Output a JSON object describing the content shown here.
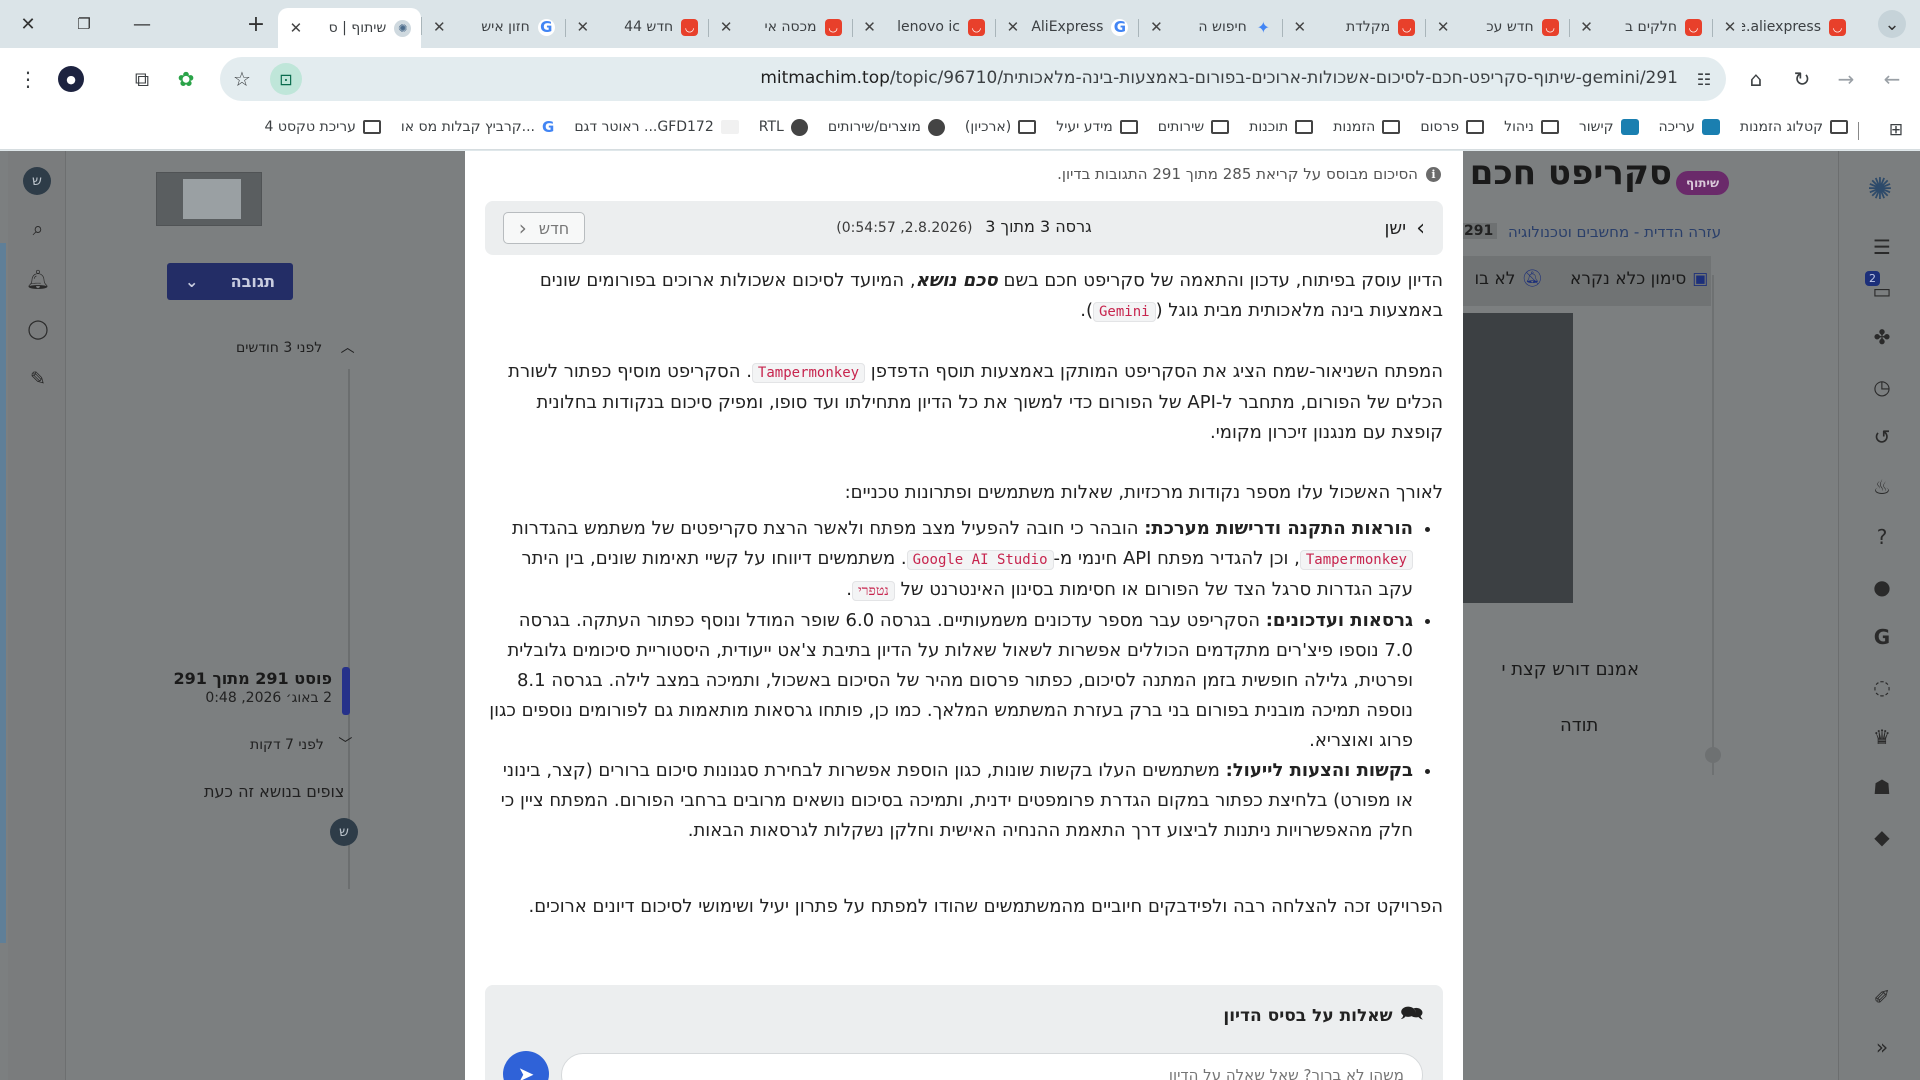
{
  "tabs": [
    {
      "title": "he.aliexpress",
      "fav": "red",
      "active": false
    },
    {
      "title": "חלקים ב",
      "fav": "red",
      "active": false
    },
    {
      "title": "חדש עכ",
      "fav": "red",
      "active": false
    },
    {
      "title": "מקלדת",
      "fav": "red",
      "active": false
    },
    {
      "title": "חיפוש ה",
      "fav": "gem",
      "active": false
    },
    {
      "title": "AliExpress",
      "fav": "g",
      "active": false
    },
    {
      "title": "lenovo ic",
      "fav": "red",
      "active": false
    },
    {
      "title": "מכסה אי",
      "fav": "red",
      "active": false
    },
    {
      "title": "חדש 44",
      "fav": "red",
      "active": false
    },
    {
      "title": "חזון איש",
      "fav": "g",
      "active": false
    },
    {
      "title": "שיתוף | ס",
      "fav": "logo",
      "active": true
    }
  ],
  "url": {
    "domain": "mitmachim.top",
    "path": "/topic/96710/שיתוף-סקריפט-חכם-לסיכום-אשכולות-ארוכים-בפורום-באמצעות-בינה-מלאכותית-gemini/291"
  },
  "bookmarks": [
    {
      "label": "קטלוג הזמנות",
      "icon": "folder"
    },
    {
      "label": "עריכה",
      "icon": "edit"
    },
    {
      "label": "קישור",
      "icon": "edit"
    },
    {
      "label": "ניהול",
      "icon": "folder"
    },
    {
      "label": "פרסום",
      "icon": "folder"
    },
    {
      "label": "הזמנות",
      "icon": "folder"
    },
    {
      "label": "תוכנות",
      "icon": "folder"
    },
    {
      "label": "שירותים",
      "icon": "folder"
    },
    {
      "label": "מידע יעיל",
      "icon": "folder"
    },
    {
      "label": "(ארכיון)",
      "icon": "folder"
    },
    {
      "label": "מוצרים/שירותים",
      "icon": "glob"
    },
    {
      "label": "RTL",
      "icon": "glob"
    },
    {
      "label": "ראוטר דגם ...GFD172",
      "icon": "blank"
    },
    {
      "label": "קרביץ קבלות מס או...",
      "icon": "g"
    },
    {
      "label": "4 עריכת טקסט",
      "icon": "folder"
    }
  ],
  "left_panel": {
    "reply_label": "תגובה",
    "ago_top": "לפני 3 חודשים",
    "post_counter": "פוסט 291 מתוך 291",
    "post_date": "2 באוג׳ 2026, 0:48",
    "ago_bottom": "לפני 7 דקות",
    "viewers": "צופים בנושא זה כעת",
    "avatar_letter": "ש"
  },
  "right_panel": {
    "topic_title": "סקריפט חכם ל",
    "share_label": "שיתוף",
    "category": "עזרה הדדית - מחשבים וטכנולוגיה",
    "count": "291",
    "mark_read": "סימון כלא נקרא",
    "not_watching": "לא בו",
    "snippet1": "אמנם דורש קצת י",
    "snippet2": "תודה",
    "notif_badge": "2"
  },
  "modal": {
    "summary_note": "הסיכום מבוסס על קריאת 285 מתוך 291 התגובות בדיון.",
    "older_label": "ישן",
    "newer_label": "חדש",
    "version_text": "גרסה 3 מתוך 3",
    "version_date": "(2.8.2026, 0:54:57)",
    "p1_a": "הדיון עוסק בפיתוח, עדכון והתאמה של סקריפט חכם בשם ",
    "p1_em": "סכם נושא",
    "p1_b": ", המיועד לסיכום אשכולות ארוכים בפורומים שונים באמצעות בינה מלאכותית מבית גוגל (",
    "p1_code": "Gemini",
    "p1_c": ").",
    "p2_a": "המפתח השניאור-שמח הציג את הסקריפט המותקן באמצעות תוסף הדפדפן ",
    "p2_code": "Tampermonkey",
    "p2_b": ". הסקריפט מוסיף כפתור לשורת הכלים של הפורום, מתחבר ל-API של הפורום כדי למשוך את כל הדיון מתחילתו ועד סופו, ומפיק סיכום בנקודות בחלונית קופצת עם מנגנון זיכרון מקומי.",
    "p3": "לאורך האשכול עלו מספר נקודות מרכזיות, שאלות משתמשים ופתרונות טכניים:",
    "li1_bold": "הוראות התקנה ודרישות מערכת:",
    "li1_a": " הובהר כי חובה להפעיל מצב מפתח ולאשר הרצת סקריפטים של משתמש בהגדרות ",
    "li1_code1": "Tampermonkey",
    "li1_b": ", וכן להגדיר מפתח API חינמי מ-",
    "li1_code2": "Google AI Studio",
    "li1_c": ". משתמשים דיווחו על קשיי תאימות שונים, בין היתר עקב הגדרות סרגל הצד של הפורום או חסימות בסינון האינטרנט של ",
    "li1_code3": "נטפרי",
    "li1_d": ".",
    "li2_bold": "גרסאות ועדכונים:",
    "li2_text": " הסקריפט עבר מספר עדכונים משמעותיים. בגרסה 6.0 שופר המודל ונוסף כפתור העתקה. בגרסה 7.0 נוספו פיצ'רים מתקדמים הכוללים אפשרות לשאול שאלות על הדיון בתיבת צ'אט ייעודית, היסטוריית סיכומים גלובלית ופרטית, גלילה חופשית בזמן המתנה לסיכום, כפתור פרסום מהיר של הסיכום באשכול, ותמיכה במצב לילה. בגרסה 8.1 נוספה תמיכה מובנית בפורום בני ברק בעזרת המשתמש המלאך. כמו כן, פותחו גרסאות מותאמות גם לפורומים נוספים כגון פרוג ואוצריא.",
    "li3_bold": "בקשות והצעות לייעול:",
    "li3_text": " משתמשים העלו בקשות שונות, כגון הוספת אפשרות לבחירת סגנונות סיכום ברורים (קצר, בינוני או מפורט) בלחיצת כפתור במקום הגדרת פרומפטים ידנית, ותמיכה בסיכום נושאים מרובים ברחבי הפורום. המפתח ציין כי חלק מהאפשרויות ניתנות לביצוע דרך התאמת ההנחיה האישית וחלקן נשקלות לגרסאות הבאות.",
    "p4": "הפרויקט זכה להצלחה רבה ולפידבקים חיוביים מהמשתמשים שהודו למפתח על פתרון יעיל ושימושי לסיכום דיונים ארוכים.",
    "qa_title": "שאלות על בסיס הדיון",
    "qa_placeholder": "משהו לא ברור? שאל שאלה על הדיון"
  }
}
